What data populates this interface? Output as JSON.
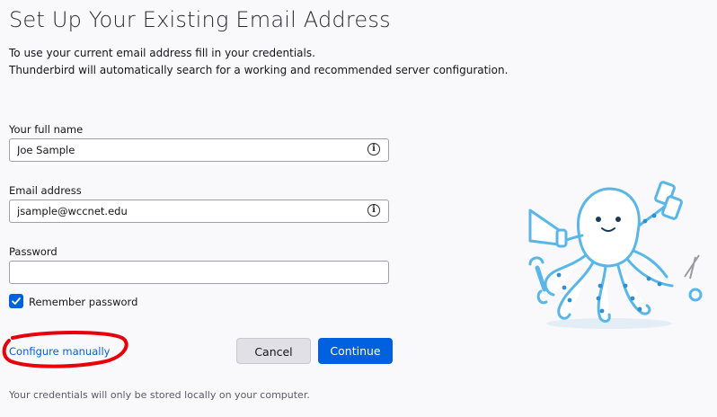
{
  "page": {
    "title": "Set Up Your Existing Email Address",
    "intro_line1": "To use your current email address fill in your credentials.",
    "intro_line2": "Thunderbird will automatically search for a working and recommended server configuration."
  },
  "form": {
    "full_name": {
      "label": "Your full name",
      "value": "Joe Sample",
      "icon": "info-icon"
    },
    "email": {
      "label": "Email address",
      "value": "jsample@wccnet.edu",
      "icon": "info-icon"
    },
    "password": {
      "label": "Password",
      "value": ""
    },
    "remember": {
      "label": "Remember password",
      "checked": true
    }
  },
  "actions": {
    "configure_manually": "Configure manually",
    "cancel": "Cancel",
    "continue": "Continue"
  },
  "footer": {
    "note": "Your credentials will only be stored locally on your computer."
  },
  "colors": {
    "accent": "#0061e0",
    "annotation": "#e8000b",
    "mascot": "#58b6e8"
  }
}
